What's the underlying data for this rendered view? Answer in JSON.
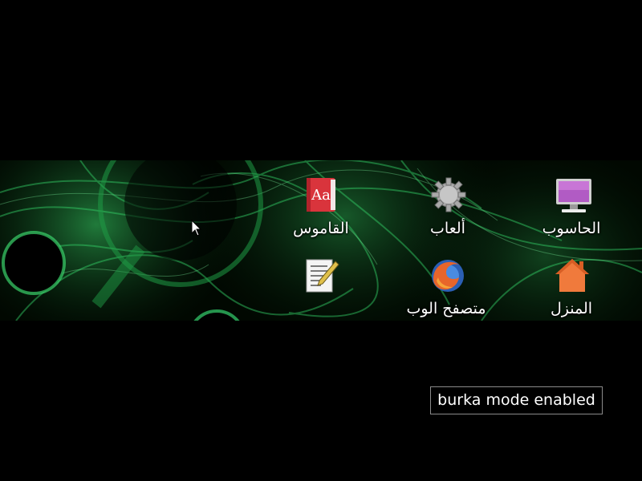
{
  "desktop": {
    "icons": [
      {
        "id": "computer",
        "label": "الحاسوب",
        "icon": "monitor-icon"
      },
      {
        "id": "games",
        "label": "ألعاب",
        "icon": "gear-icon"
      },
      {
        "id": "dictionary",
        "label": "القاموس",
        "icon": "dictionary-book-icon",
        "glyph_text": "Aa"
      },
      {
        "id": "home",
        "label": "المنزل",
        "icon": "home-folder-icon"
      },
      {
        "id": "browser",
        "label": "متصفح الوب",
        "icon": "firefox-icon"
      },
      {
        "id": "text-editor",
        "label": "",
        "icon": "text-editor-icon"
      }
    ]
  },
  "notification": {
    "text": "burka mode enabled"
  },
  "colors": {
    "wallpaper_green": "#22c55a",
    "background": "#000000",
    "dictionary_red": "#d9343c",
    "home_orange": "#f07a3c",
    "monitor_purple": "#b15bc4"
  }
}
